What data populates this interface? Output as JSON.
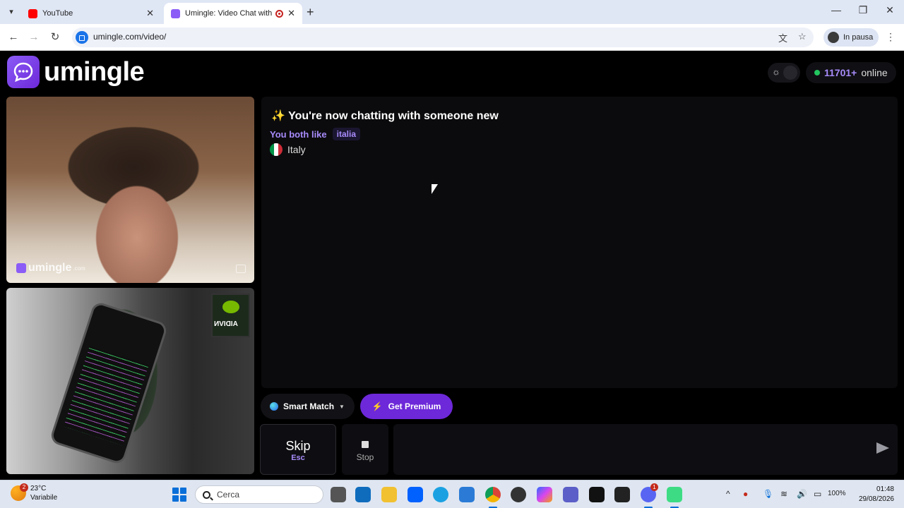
{
  "browser": {
    "tabs": [
      {
        "title": "YouTube",
        "active": false
      },
      {
        "title": "Umingle: Video Chat with S",
        "active": true
      }
    ],
    "url": "umingle.com/video/",
    "profile_label": "In pausa"
  },
  "site": {
    "logo_text": "umingle",
    "online_count": "11701+",
    "online_label": "online",
    "watermark_text": "umingle",
    "watermark_domain": ".com",
    "remote_video_logo": "AIDIVN"
  },
  "chat": {
    "title": "✨ You're now chatting with someone new",
    "both_like_label": "You both like",
    "interest_tag": "italia",
    "country": "Italy"
  },
  "controls": {
    "smart_match_label": "Smart Match",
    "premium_label": "Get Premium",
    "skip_label": "Skip",
    "skip_shortcut": "Esc",
    "stop_label": "Stop",
    "message_placeholder": ""
  },
  "taskbar": {
    "weather_temp": "23°C",
    "weather_desc": "Variabile",
    "weather_badge": "2",
    "search_placeholder": "Cerca",
    "discord_badge": "1",
    "battery": "100%",
    "time": "01:48",
    "date": "29/08/2026"
  },
  "colors": {
    "brand_purple": "#6d28d9",
    "accent_lavender": "#a78bfa",
    "online_green": "#22c55e"
  }
}
